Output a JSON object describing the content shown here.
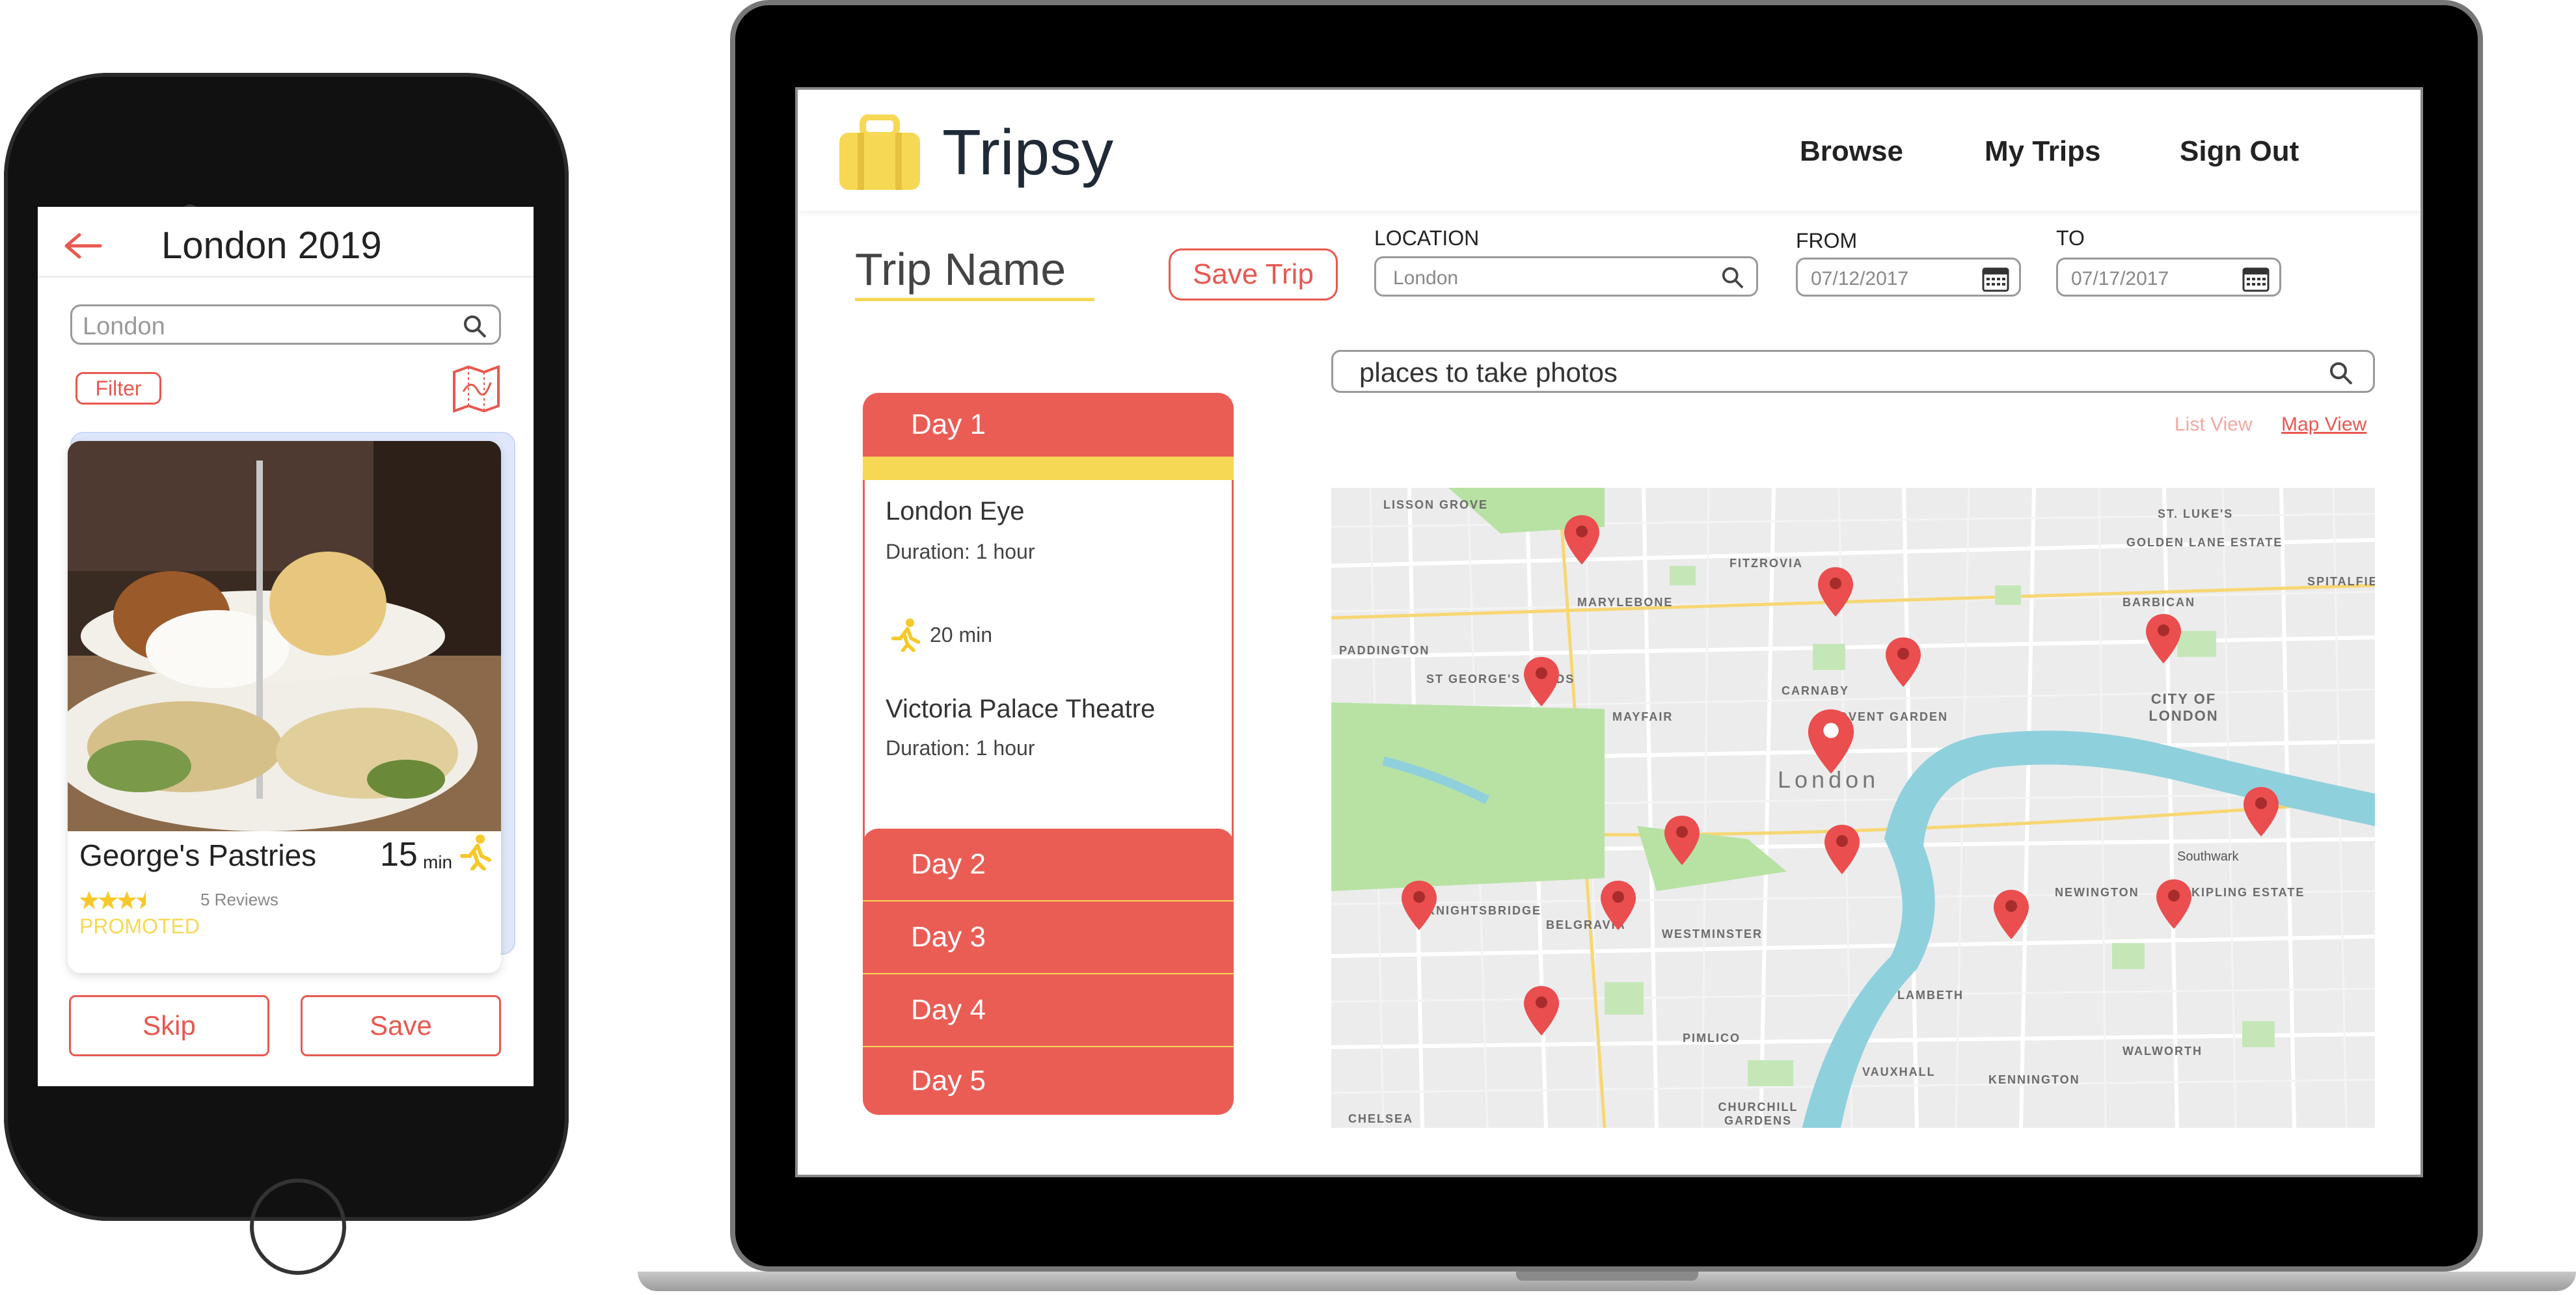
{
  "phone": {
    "title": "London 2019",
    "search": {
      "value": "London"
    },
    "filter_label": "Filter",
    "card": {
      "name": "George's Pastries",
      "time_value": "15",
      "time_unit": "min",
      "rating": 3.5,
      "reviews": "5 Reviews",
      "promoted": "PROMOTED"
    },
    "skip_label": "Skip",
    "save_label": "Save"
  },
  "web": {
    "brand": "Tripsy",
    "nav": {
      "browse": "Browse",
      "my_trips": "My Trips",
      "sign_out": "Sign Out"
    },
    "trip_name": "Trip Name",
    "save_trip_label": "Save Trip",
    "location": {
      "label": "LOCATION",
      "value": "London"
    },
    "from": {
      "label": "FROM",
      "value": "07/12/2017"
    },
    "to": {
      "label": "TO",
      "value": "07/17/2017"
    },
    "search": {
      "value": "places to take photos"
    },
    "view_toggle": {
      "list": "List View",
      "map": "Map View"
    },
    "days": [
      {
        "label": "Day 1"
      },
      {
        "label": "Day 2"
      },
      {
        "label": "Day 3"
      },
      {
        "label": "Day 4"
      },
      {
        "label": "Day 5"
      }
    ],
    "day1_items": [
      {
        "name": "London Eye",
        "duration": "Duration: 1 hour"
      },
      {
        "name": "Victoria Palace Theatre",
        "duration": "Duration: 1 hour"
      }
    ],
    "travel_time": "20 min",
    "map_labels": [
      "LISSON GROVE",
      "FITZROVIA",
      "ST. LUKE'S",
      "GOLDEN LANE ESTATE",
      "SPITALFIELDS",
      "MARYLEBONE",
      "BARBICAN",
      "PADDINGTON",
      "ST GEORGE'S FIELDS",
      "CARNABY",
      "MAYFAIR",
      "COVENT GARDEN",
      "CITY OF LONDON",
      "London",
      "Southwark",
      "KNIGHTSBRIDGE",
      "BELGRAVIA",
      "WESTMINSTER",
      "NEWINGTON",
      "KIPLING ESTATE",
      "LAMBETH",
      "PIMLICO",
      "VAUXHALL",
      "KENNINGTON",
      "WALWORTH",
      "CHURCHILL GARDENS",
      "CHELSEA"
    ]
  },
  "colors": {
    "accent_red": "#ea5d55",
    "accent_yellow": "#f6d855",
    "map_water": "#8fd0dd",
    "map_park": "#b7e2a3",
    "map_bg": "#ececec"
  }
}
